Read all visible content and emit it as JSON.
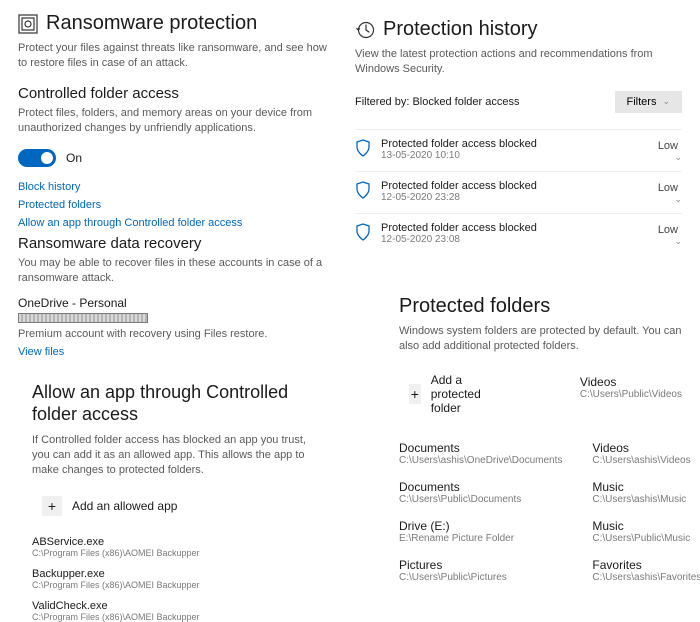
{
  "left": {
    "title": "Ransomware protection",
    "desc": "Protect your files against threats like ransomware, and see how to restore files in case of an attack.",
    "cfa": {
      "title": "Controlled folder access",
      "desc": "Protect files, folders, and memory areas on your device from unauthorized changes by unfriendly applications.",
      "toggle_label": "On",
      "links": [
        "Block history",
        "Protected folders",
        "Allow an app through Controlled folder access"
      ]
    },
    "recovery": {
      "title": "Ransomware data recovery",
      "desc": "You may be able to recover files in these accounts in case of a ransomware attack.",
      "account": "OneDrive - Personal",
      "note": "Premium account with recovery using Files restore.",
      "link": "View files"
    },
    "allow": {
      "title": "Allow an app through Controlled folder access",
      "desc": "If Controlled folder access has blocked an app you trust, you can add it as an allowed app. This allows the app to make changes to protected folders.",
      "add_label": "Add an allowed app",
      "apps": [
        {
          "name": "ABService.exe",
          "path": "C:\\Program Files (x86)\\AOMEI Backupper"
        },
        {
          "name": "Backupper.exe",
          "path": "C:\\Program Files (x86)\\AOMEI Backupper"
        },
        {
          "name": "ValidCheck.exe",
          "path": "C:\\Program Files (x86)\\AOMEI Backupper"
        }
      ]
    }
  },
  "right": {
    "history": {
      "title": "Protection history",
      "desc": "View the latest protection actions and recommendations from Windows Security.",
      "filter_label": "Filtered by: Blocked folder access",
      "filter_btn": "Filters",
      "items": [
        {
          "title": "Protected folder access blocked",
          "date": "13-05-2020 10:10",
          "severity": "Low"
        },
        {
          "title": "Protected folder access blocked",
          "date": "12-05-2020 23:28",
          "severity": "Low"
        },
        {
          "title": "Protected folder access blocked",
          "date": "12-05-2020 23:08",
          "severity": "Low"
        }
      ]
    },
    "protected": {
      "title": "Protected folders",
      "desc": "Windows system folders are protected by default. You can also add additional protected folders.",
      "add_label": "Add a protected folder",
      "col1": [
        {
          "name": "Documents",
          "path": "C:\\Users\\ashis\\OneDrive\\Documents"
        },
        {
          "name": "Documents",
          "path": "C:\\Users\\Public\\Documents"
        },
        {
          "name": "Drive (E:)",
          "path": "E:\\Rename Picture Folder"
        },
        {
          "name": "Pictures",
          "path": "C:\\Users\\Public\\Pictures"
        }
      ],
      "col2": [
        {
          "name": "Videos",
          "path": "C:\\Users\\Public\\Videos"
        },
        {
          "name": "Videos",
          "path": "C:\\Users\\ashis\\Videos"
        },
        {
          "name": "Music",
          "path": "C:\\Users\\ashis\\Music"
        },
        {
          "name": "Music",
          "path": "C:\\Users\\Public\\Music"
        },
        {
          "name": "Favorites",
          "path": "C:\\Users\\ashis\\Favorites"
        }
      ]
    }
  }
}
